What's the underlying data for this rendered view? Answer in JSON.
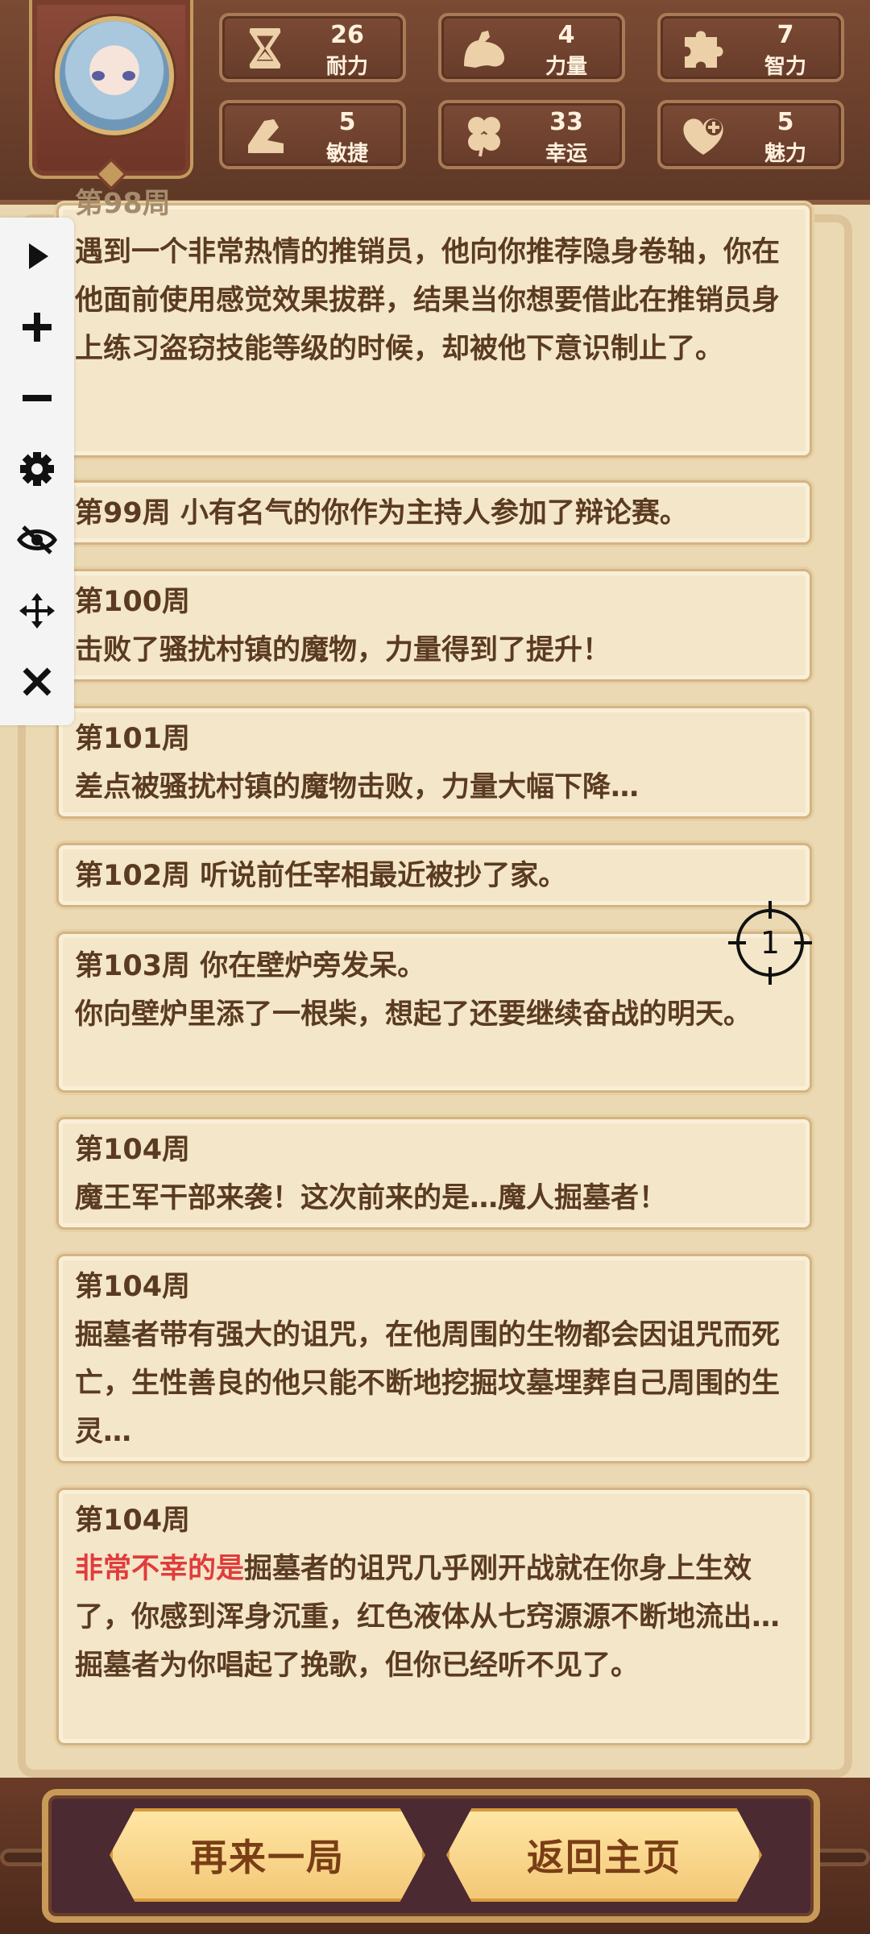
{
  "header": {
    "stats": [
      {
        "icon": "hourglass-icon",
        "value": "26",
        "label": "耐力"
      },
      {
        "icon": "muscle-arm-icon",
        "value": "4",
        "label": "力量"
      },
      {
        "icon": "puzzle-icon",
        "value": "7",
        "label": "智力"
      },
      {
        "icon": "boot-icon",
        "value": "5",
        "label": "敏捷"
      },
      {
        "icon": "clover-icon",
        "value": "33",
        "label": "幸运"
      },
      {
        "icon": "heart-plus-icon",
        "value": "5",
        "label": "魅力"
      }
    ]
  },
  "log": [
    {
      "lines": [
        "第98周",
        "遇到一个非常热情的推销员，他向你推荐隐身卷轴，你在他面前使用感觉效果拔群，结果当你想要借此在推销员身上练习盗窃技能等级的时候，却被他下意识制止了。"
      ]
    },
    {
      "lines": [
        "第99周 小有名气的你作为主持人参加了辩论赛。"
      ]
    },
    {
      "lines": [
        "第100周",
        "击败了骚扰村镇的魔物，力量得到了提升！"
      ]
    },
    {
      "lines": [
        "第101周",
        "差点被骚扰村镇的魔物击败，力量大幅下降…"
      ]
    },
    {
      "lines": [
        "第102周 听说前任宰相最近被抄了家。"
      ]
    },
    {
      "lines": [
        "第103周 你在壁炉旁发呆。",
        "你向壁炉里添了一根柴，想起了还要继续奋战的明天。"
      ]
    },
    {
      "lines": [
        "第104周",
        "魔王军干部来袭！这次前来的是…魔人掘墓者！"
      ]
    },
    {
      "lines": [
        "第104周",
        "掘墓者带有强大的诅咒，在他周围的生物都会因诅咒而死亡，生性善良的他只能不断地挖掘坟墓埋葬自己周围的生灵…"
      ]
    },
    {
      "title": "第104周",
      "highlight": "非常不幸的是",
      "rest": "掘墓者的诅咒几乎刚开战就在你身上生效了，你感到浑身沉重，红色液体从七窍源源不断地流出…掘墓者为你唱起了挽歌，但你已经听不见了。"
    }
  ],
  "marker": {
    "label": "1"
  },
  "footer": {
    "again_label": "再来一局",
    "home_label": "返回主页"
  },
  "toolbar": {
    "icons": [
      "play-icon",
      "plus-icon",
      "minus-icon",
      "gear-icon",
      "eye-off-icon",
      "move-icon",
      "close-icon"
    ]
  }
}
